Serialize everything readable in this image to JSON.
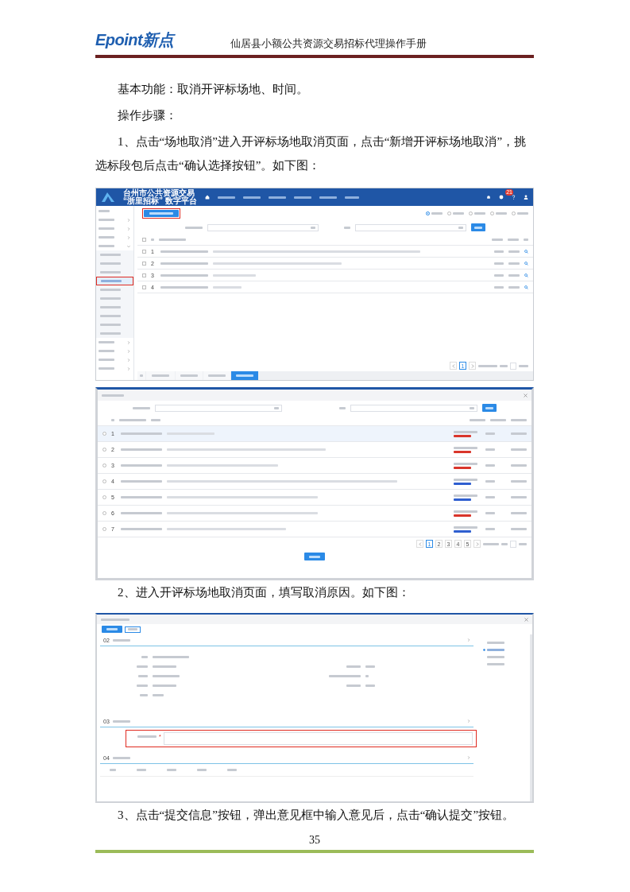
{
  "header": {
    "logo": "Epoint新点",
    "title": "仙居县小额公共资源交易招标代理操作手册"
  },
  "blocks": [
    {
      "kind": "text",
      "text": "基本功能：取消开评标场地、时间。"
    },
    {
      "kind": "text",
      "text": "操作步骤："
    },
    {
      "kind": "text",
      "text": "1、点击“场地取消”进入开评标场地取消页面，点击“新增开评标场地取消”，挑选标段包后点击“确认选择按钮”。如下图："
    },
    {
      "kind": "list_screen"
    },
    {
      "kind": "picker_screen"
    },
    {
      "kind": "text",
      "text": "2、进入开评标场地取消页面，填写取消原因。如下图："
    },
    {
      "kind": "form_screen"
    },
    {
      "kind": "text",
      "text": "3、点击“提交信息”按钮，弹出意见框中输入意见后，点击“确认提交”按钮。"
    }
  ],
  "list_screen": {
    "platform_title": [
      "台州市公共资源交易",
      "“浙里招标” 数字平台"
    ],
    "badge": "21",
    "filters": [
      {
        "selected": true
      },
      {
        "selected": false
      },
      {
        "selected": false
      },
      {
        "selected": false
      },
      {
        "selected": false
      }
    ],
    "sidebar": [
      {
        "expanded": false
      },
      {
        "expanded": false
      },
      {
        "expanded": false
      },
      {
        "expanded": true,
        "children": [
          {
            "selected": false
          },
          {
            "selected": false
          },
          {
            "selected": false
          },
          {
            "selected": true
          },
          {
            "selected": false
          },
          {
            "selected": false
          },
          {
            "selected": false
          },
          {
            "selected": false
          },
          {
            "selected": false
          },
          {
            "selected": false
          }
        ]
      },
      {
        "expanded": false
      },
      {
        "expanded": false
      },
      {
        "expanded": false
      },
      {
        "expanded": false
      }
    ],
    "rows": [
      {
        "seq": "1",
        "checked": false
      },
      {
        "seq": "2",
        "checked": false
      },
      {
        "seq": "3",
        "checked": false
      },
      {
        "seq": "4",
        "checked": false
      }
    ],
    "page": "1",
    "tabs": [
      {
        "selected": false
      },
      {
        "selected": false
      },
      {
        "selected": false
      },
      {
        "selected": false
      },
      {
        "selected": true
      }
    ]
  },
  "picker_screen": {
    "rows": [
      {
        "seq": "1",
        "selected": true,
        "color": "#d9352b"
      },
      {
        "seq": "2",
        "selected": false,
        "color": "#d9352b"
      },
      {
        "seq": "3",
        "selected": false,
        "color": "#d9352b"
      },
      {
        "seq": "4",
        "selected": false,
        "color": "#2f5fd0"
      },
      {
        "seq": "5",
        "selected": false,
        "color": "#2f5fd0"
      },
      {
        "seq": "6",
        "selected": false,
        "color": "#d9352b"
      },
      {
        "seq": "7",
        "selected": false,
        "color": "#2f5fd0"
      }
    ],
    "pages": [
      {
        "label": "1",
        "selected": true
      },
      {
        "label": "2",
        "selected": false
      },
      {
        "label": "3",
        "selected": false
      },
      {
        "label": "4",
        "selected": false
      },
      {
        "label": "5",
        "selected": false
      }
    ]
  },
  "form_screen": {
    "sections": [
      {
        "number": "02"
      },
      {
        "number": "03"
      },
      {
        "number": "04"
      }
    ],
    "required_mark": "*",
    "anchors": [
      {
        "selected": false
      },
      {
        "selected": true
      },
      {
        "selected": false
      },
      {
        "selected": false
      }
    ]
  },
  "page_number": "35"
}
